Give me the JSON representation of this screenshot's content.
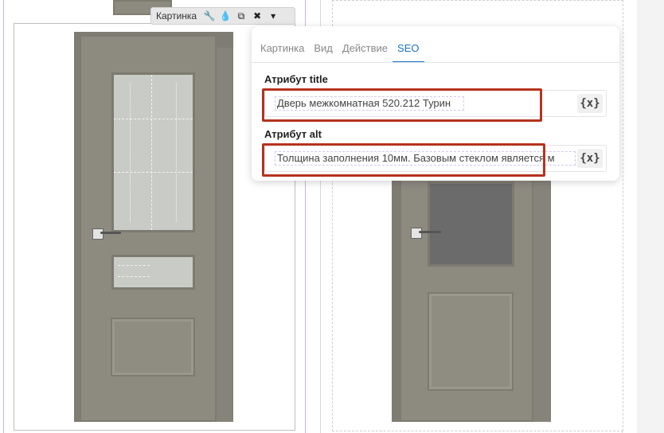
{
  "toolbar": {
    "label": "Картинка",
    "icons": [
      "wrench-icon",
      "drop-icon",
      "copy-icon",
      "close-icon",
      "caret-down-icon"
    ],
    "glyphs": {
      "wrench": "🔧",
      "drop": "💧",
      "copy": "⧉",
      "close": "✖",
      "caret": "▾"
    }
  },
  "popup": {
    "tabs": [
      {
        "label": "Картинка",
        "active": false
      },
      {
        "label": "Вид",
        "active": false
      },
      {
        "label": "Действие",
        "active": false
      },
      {
        "label": "SEO",
        "active": true
      }
    ],
    "title_field": {
      "label": "Атрибут title",
      "value": "Дверь межкомнатная 520.212 Турин",
      "var_button": "{x}"
    },
    "alt_field": {
      "label": "Атрибут alt",
      "value": "Толщина заполнения 10мм. Базовым стеклом является м",
      "var_button": "{x}"
    }
  },
  "colors": {
    "accent": "#1a73c8",
    "highlight": "#b5331e",
    "door": "#8d8a80"
  }
}
